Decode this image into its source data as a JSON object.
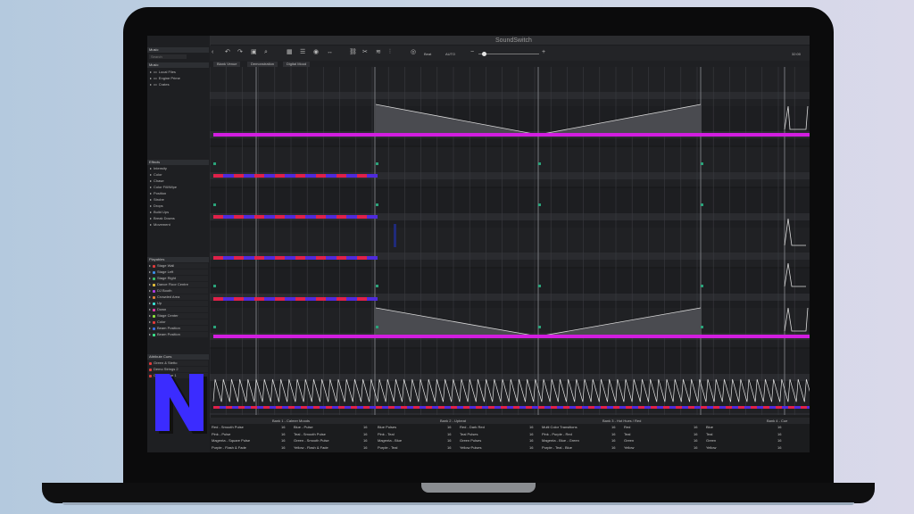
{
  "app": {
    "title": "SoundSwitch",
    "time_readout": "32:00",
    "bpm": "Beat",
    "auto": "AUTO"
  },
  "sidebar": {
    "search_placeholder": "Search",
    "sections": {
      "music": "Music",
      "effects": "Effects",
      "playables": "Playables",
      "attributes": "Attribute Cues"
    },
    "music_items": [
      "Local Files",
      "Engine Prime",
      "Crates"
    ],
    "effect_items": [
      "Intensity",
      "Color",
      "Chase",
      "Color Fill/Wipe",
      "Position",
      "Strobe",
      "Drops",
      "Build Ups",
      "Break Downs",
      "Movement"
    ],
    "playable_items": [
      {
        "label": "Stage Wall",
        "color": "#e23b3b"
      },
      {
        "label": "Stage Left",
        "color": "#3a8ee6"
      },
      {
        "label": "Stage Right",
        "color": "#3ac46a"
      },
      {
        "label": "Dance Floor Centre",
        "color": "#e6c13a"
      },
      {
        "label": "DJ Booth",
        "color": "#b03ae6"
      },
      {
        "label": "Crowded Area",
        "color": "#e6803a"
      },
      {
        "label": "Up",
        "color": "#3ae6d6"
      },
      {
        "label": "Down",
        "color": "#e63aa7"
      },
      {
        "label": "Stage Center",
        "color": "#8ee63a"
      },
      {
        "label": "Color",
        "color": "#e63a3a"
      },
      {
        "label": "Beam Position",
        "color": "#3a6ee6"
      },
      {
        "label": "Beam Position",
        "color": "#3ae68c"
      }
    ],
    "attribute_items": [
      "Green & Stetto",
      "Demo Strings 2",
      "Custom Cue 1"
    ]
  },
  "toolbar": {
    "tabs": [
      "Blank Venue",
      "Demonstration",
      "Digital Mood"
    ]
  },
  "bottom_grid": {
    "headers": [
      "Bank 1 - Calmer Moods",
      "Bank 2 - Upbeat",
      "Bank 3 - Hot Hues / Red",
      "Bank 4 - Cue"
    ],
    "rows": [
      [
        "Red - Smooth Pulse",
        "Blue - Pulse",
        "Blue Pulses",
        "Red - Dark Red",
        "Multi Color Transitions",
        "Red",
        "Blue"
      ],
      [
        "Pink - Pulse",
        "Teal - Smooth Pulse",
        "Pink - Teal",
        "Teal Pulses",
        "Pink - Purple - Red",
        "Teal",
        "Teal"
      ],
      [
        "Magenta - Square Pulse",
        "Green - Smooth Pulse",
        "Magenta - Blue",
        "Green Pulses",
        "Magenta - Blue - Green",
        "Green",
        "Green"
      ],
      [
        "Purple - Flash & Fade",
        "Yellow - Flash & Fade",
        "Purple - Teal",
        "Yellow Pulses",
        "Purple - Teal - Blue",
        "Yellow",
        "Yellow"
      ]
    ],
    "nums": [
      "16",
      "16",
      "16",
      "16",
      "16",
      "16",
      "16"
    ]
  },
  "colors": {
    "magenta": "#d21ee0",
    "blue": "#4f2bdc",
    "red": "#e0214a",
    "logo_blue": "#3b2cff"
  },
  "logo": {
    "letter": "N"
  }
}
